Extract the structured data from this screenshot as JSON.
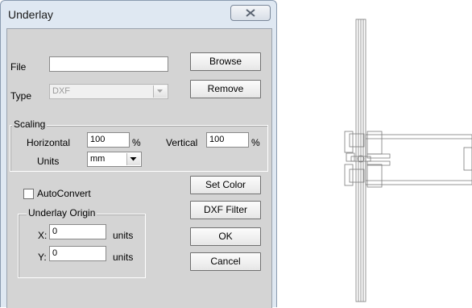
{
  "dialog": {
    "title": "Underlay",
    "file_label": "File",
    "file_value": "",
    "browse_label": "Browse",
    "type_label": "Type",
    "type_value": "DXF",
    "remove_label": "Remove",
    "scaling": {
      "title": "Scaling",
      "horizontal_label": "Horizontal",
      "horizontal_value": "100",
      "vertical_label": "Vertical",
      "vertical_value": "100",
      "percent": "%",
      "units_label": "Units",
      "units_value": "mm"
    },
    "autoconvert_label": "AutoConvert",
    "set_color_label": "Set Color",
    "dxf_filter_label": "DXF Filter",
    "origin": {
      "title": "Underlay Origin",
      "x_label": "X:",
      "x_value": "0",
      "y_label": "Y:",
      "y_value": "0",
      "units": "units"
    },
    "ok_label": "OK",
    "cancel_label": "Cancel"
  },
  "icons": {
    "close": "close-icon",
    "dropdown": "chevron-down-icon"
  }
}
